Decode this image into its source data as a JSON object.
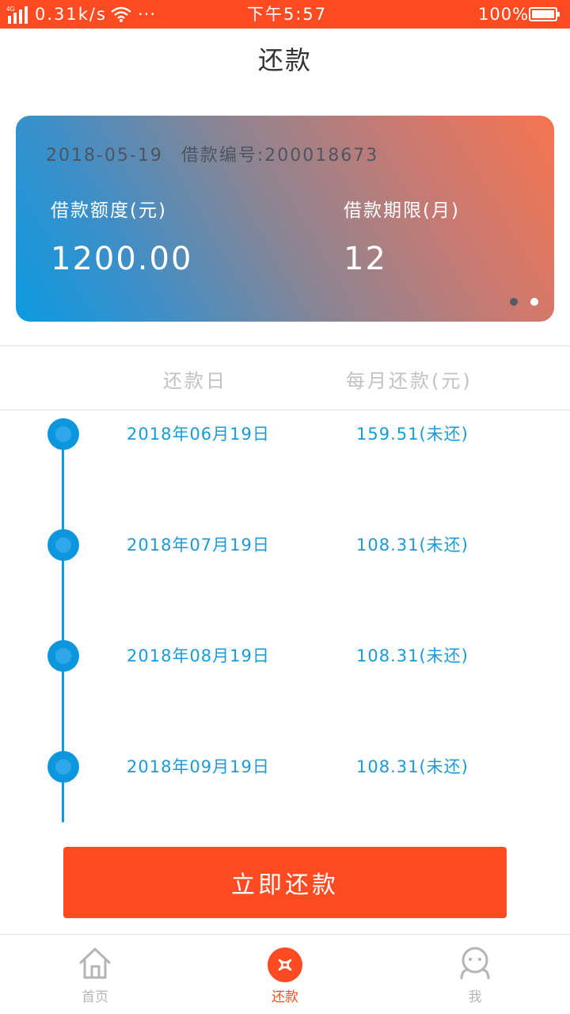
{
  "status_bar": {
    "network": "4G",
    "speed": "0.31k/s",
    "dots": "···",
    "time": "下午5:57",
    "battery": "100%"
  },
  "header": {
    "title": "还款"
  },
  "loan_card": {
    "date": "2018-05-19",
    "loan_no_label": "借款编号:",
    "loan_no": "200018673",
    "amount_label": "借款额度(元)",
    "amount_value": "1200.00",
    "term_label": "借款期限(月)",
    "term_value": "12",
    "pager": {
      "count": 2,
      "active": 2
    }
  },
  "table": {
    "col_date": "还款日",
    "col_amount": "每月还款(元)",
    "rows": [
      {
        "date": "2018年06月19日",
        "amount": "159.51(未还)"
      },
      {
        "date": "2018年07月19日",
        "amount": "108.31(未还)"
      },
      {
        "date": "2018年08月19日",
        "amount": "108.31(未还)"
      },
      {
        "date": "2018年09月19日",
        "amount": "108.31(未还)"
      }
    ]
  },
  "repay_button": {
    "label": "立即还款"
  },
  "bottom_nav": {
    "items": [
      {
        "label": "首页",
        "icon": "home-icon"
      },
      {
        "label": "还款",
        "icon": "repay-icon",
        "active": true
      },
      {
        "label": "我",
        "icon": "profile-icon"
      }
    ]
  },
  "colors": {
    "accent": "#fe4b21",
    "timeline": "#159ae0",
    "card_gradient_start": "#0c9ae0",
    "card_gradient_end": "#f5754f"
  }
}
